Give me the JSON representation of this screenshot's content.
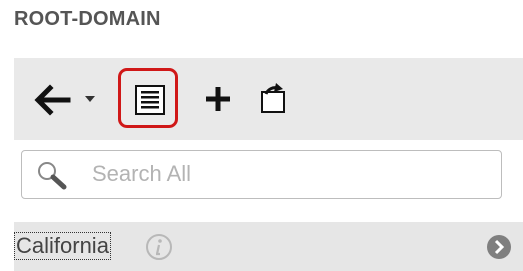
{
  "header": {
    "title": "ROOT-DOMAIN"
  },
  "toolbar": {
    "buttons": [
      {
        "icon": "back-arrow-icon"
      },
      {
        "icon": "dropdown-arrow-icon"
      },
      {
        "icon": "list-view-icon",
        "highlight_color": "#d01818"
      },
      {
        "icon": "add-icon"
      },
      {
        "icon": "refresh-icon"
      }
    ]
  },
  "search": {
    "placeholder": "Search All",
    "value": ""
  },
  "tree": {
    "items": [
      {
        "label": "California",
        "info_icon": "info-icon",
        "expand_icon": "chevron-right-icon"
      }
    ]
  }
}
